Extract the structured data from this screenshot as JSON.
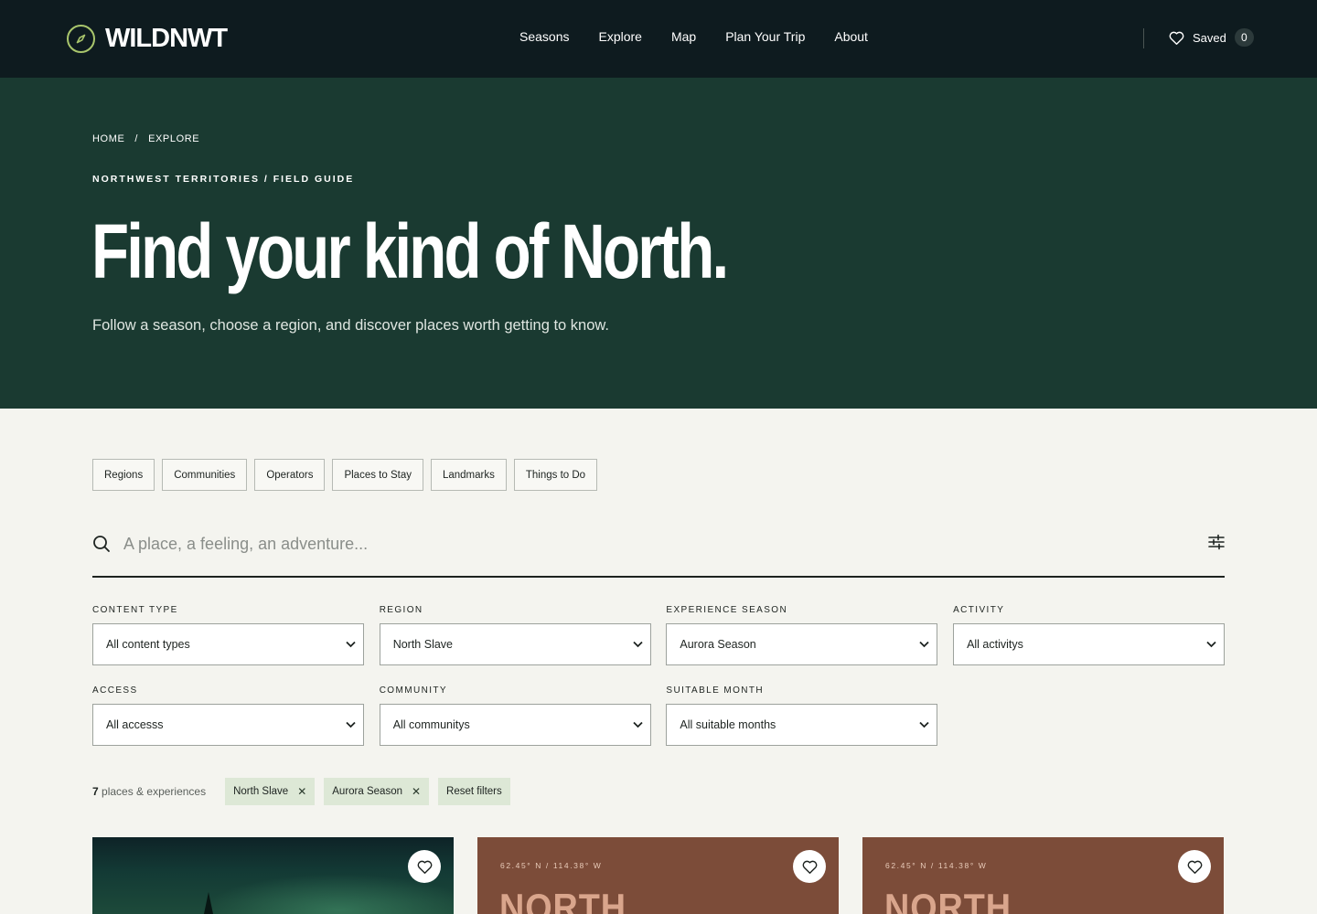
{
  "header": {
    "brand": "WILDNWT",
    "nav": [
      "Seasons",
      "Explore",
      "Map",
      "Plan Your Trip",
      "About"
    ],
    "saved_label": "Saved",
    "saved_count": "0"
  },
  "hero": {
    "breadcrumb": {
      "home": "HOME",
      "separator": "/",
      "current": "EXPLORE"
    },
    "eyebrow": "NORTHWEST TERRITORIES / FIELD GUIDE",
    "title": "Find your kind of North.",
    "subtitle": "Follow a season, choose a region, and discover places worth getting to know."
  },
  "content_chips": [
    "Regions",
    "Communities",
    "Operators",
    "Places to Stay",
    "Landmarks",
    "Things to Do"
  ],
  "search": {
    "placeholder": "A place, a feeling, an adventure..."
  },
  "filters": [
    {
      "label": "CONTENT TYPE",
      "value": "All content types"
    },
    {
      "label": "REGION",
      "value": "North Slave"
    },
    {
      "label": "EXPERIENCE SEASON",
      "value": "Aurora Season"
    },
    {
      "label": "ACTIVITY",
      "value": "All activitys"
    },
    {
      "label": "ACCESS",
      "value": "All accesss"
    },
    {
      "label": "COMMUNITY",
      "value": "All communitys"
    },
    {
      "label": "SUITABLE MONTH",
      "value": "All suitable months"
    }
  ],
  "results": {
    "count": "7",
    "count_label": "places & experiences",
    "active_filters": [
      "North Slave",
      "Aurora Season"
    ],
    "reset_label": "Reset filters"
  },
  "cards": [
    {
      "kind": "aurora-photo"
    },
    {
      "kind": "placeholder",
      "coords": "62.45° N / 114.38° W",
      "word": "NORTH"
    },
    {
      "kind": "placeholder",
      "coords": "62.45° N / 114.38° W",
      "word": "NORTH"
    }
  ],
  "colors": {
    "topbar": "#0e1b1f",
    "hero": "#1a3a31",
    "page": "#f4f4ef",
    "accent_green": "#a9c66c",
    "tag_bg": "#dde8d6",
    "card_brown": "#7c4c39"
  },
  "icons": {
    "logo": "compass-icon",
    "saved": "heart-icon",
    "search": "search-icon",
    "filters": "sliders-icon",
    "remove": "close-icon",
    "select": "chevron-down-icon",
    "favorite": "heart-icon"
  }
}
